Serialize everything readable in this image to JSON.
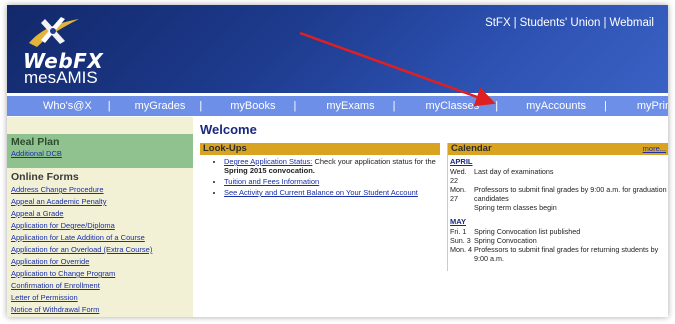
{
  "header": {
    "logo_text": "WebFX",
    "app_name": "mesAMIS",
    "top_links": [
      "StFX",
      "Students' Union",
      "Webmail"
    ]
  },
  "nav": {
    "items": [
      "Who's@X",
      "myGrades",
      "myBooks",
      "myExams",
      "myClasses",
      "myAccounts",
      "myPrinting"
    ]
  },
  "sidebar": {
    "meal_plan": {
      "heading": "Meal Plan",
      "links": [
        "Additional DCB"
      ]
    },
    "online_forms": {
      "heading": "Online Forms",
      "links": [
        "Address Change Procedure",
        "Appeal an Academic Penalty",
        "Appeal a Grade",
        "Application for Degree/Diploma",
        "Application for Late Addition of a Course",
        "Application for an Overload (Extra Course)",
        "Application for Override",
        "Application to Change Program",
        "Confirmation of Enrollment",
        "Letter of Permission",
        "Notice of Withdrawal Form"
      ]
    }
  },
  "main": {
    "welcome": "Welcome",
    "lookups": {
      "heading": "Look-Ups",
      "item1_link": "Degree Application Status:",
      "item1_text": " Check your application status for the ",
      "item1_bold": "Spring 2015 convocation.",
      "item2_link": "Tuition and Fees Information",
      "item3_link": "See Activity and Current Balance on Your Student Account"
    },
    "calendar": {
      "heading": "Calendar",
      "more": "more...",
      "months": [
        {
          "name": "APRIL",
          "events": [
            {
              "date": "Wed. 22",
              "text": "Last day of examinations"
            },
            {
              "date": "Mon. 27",
              "text": "Professors to submit final grades by 9:00 a.m. for graduation candidates"
            },
            {
              "date": "",
              "text": "Spring term classes begin"
            }
          ]
        },
        {
          "name": "MAY",
          "events": [
            {
              "date": "Fri. 1",
              "text": "Spring Convocation list published"
            },
            {
              "date": "Sun. 3",
              "text": "Spring Convocation"
            },
            {
              "date": "Mon. 4",
              "text": "Professors to submit final grades for returning students by 9:00 a.m."
            }
          ]
        }
      ]
    }
  },
  "colors": {
    "header_bg": "#1d3a8c",
    "nav_bg": "#6d8fe8",
    "sidebar_bg": "#f2f1d6",
    "meal_plan_bg": "#8fc28f",
    "panel_header_bg": "#d9a322",
    "annotation_arrow": "#e02020"
  }
}
